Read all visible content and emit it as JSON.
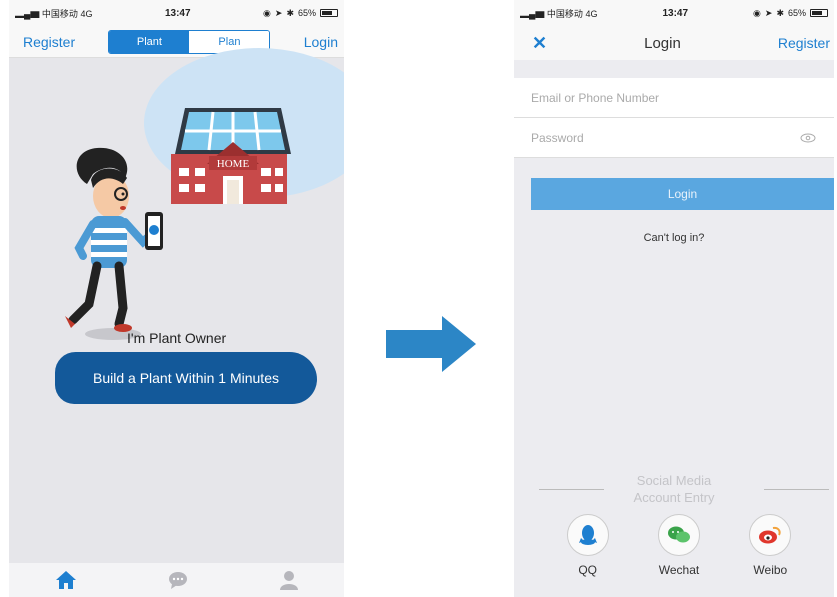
{
  "status": {
    "carrier": "中国移动",
    "network": "4G",
    "time": "13:47",
    "battery": "65%"
  },
  "left": {
    "nav": {
      "register": "Register",
      "login": "Login"
    },
    "segment": {
      "plant": "Plant",
      "plan": "Plan"
    },
    "house_sign": "HOME",
    "owner_text": "I'm Plant Owner",
    "cta": "Build a Plant Within 1 Minutes",
    "tabbar": [
      "home-icon",
      "chat-icon",
      "user-icon"
    ]
  },
  "right": {
    "nav": {
      "close": "✕",
      "title": "Login",
      "register": "Register"
    },
    "email_placeholder": "Email or Phone Number",
    "password_placeholder": "Password",
    "login_button": "Login",
    "cant_login": "Can't log in?",
    "social_title_line1": "Social Media",
    "social_title_line2": "Account Entry",
    "social": [
      {
        "label": "QQ",
        "icon": "qq-icon",
        "color": "#1e7fd0"
      },
      {
        "label": "Wechat",
        "icon": "wechat-icon",
        "color": "#3aa34a"
      },
      {
        "label": "Weibo",
        "icon": "weibo-icon",
        "color": "#e0362c"
      }
    ]
  },
  "colors": {
    "accent": "#1e7fd0",
    "cta": "#13599a",
    "login_button": "#5aa7e0",
    "arrow": "#2c86c6"
  }
}
